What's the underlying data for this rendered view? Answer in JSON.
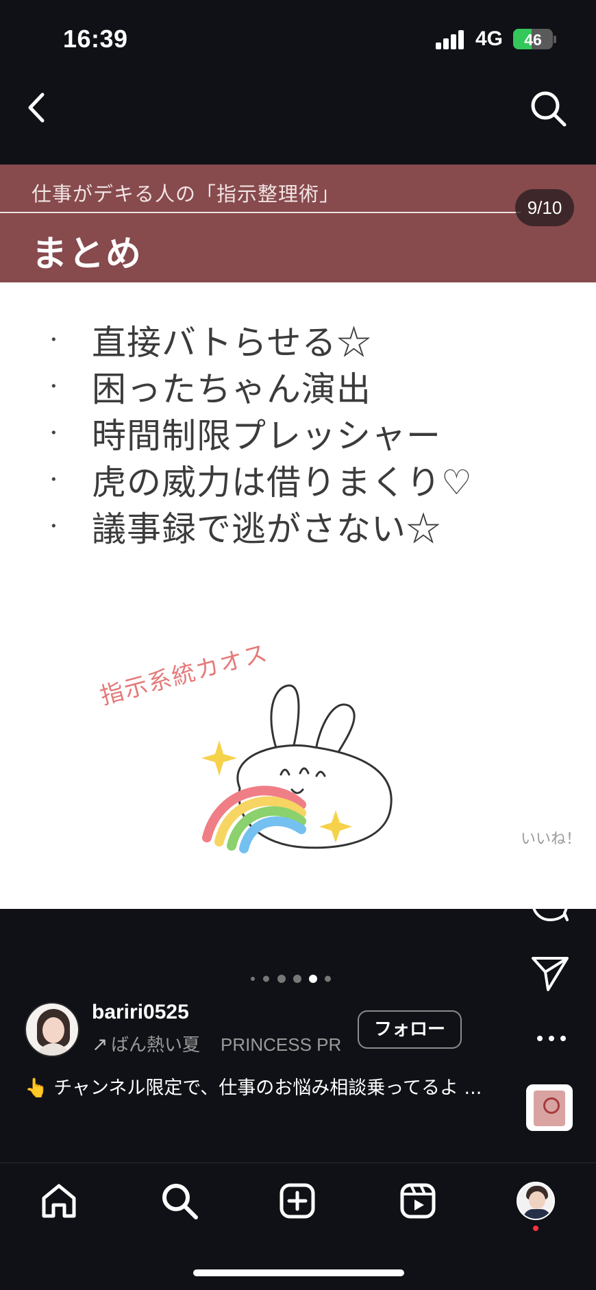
{
  "status_bar": {
    "time": "16:39",
    "network": "4G",
    "battery": "46",
    "battery_level": 0.46
  },
  "nav": {
    "back_icon": "chevron-left-icon",
    "search_icon": "search-icon"
  },
  "post": {
    "subtitle": "仕事がデキる人の「指示整理術」",
    "title": "まとめ",
    "page_counter": "9/10",
    "bullets": [
      "直接バトらせる☆",
      "困ったちゃん演出",
      "時間制限プレッシャー",
      "虎の威力は借りまくり♡",
      "議事録で逃がさない☆"
    ],
    "handwritten_label": "指示系統カオス",
    "colors": {
      "header": "#874a4d",
      "accent_text": "#e47a7a"
    }
  },
  "actions": {
    "like_label": "いいね！"
  },
  "carousel": {
    "total_dots": 6,
    "active_index": 4
  },
  "author": {
    "username": "bariri0525",
    "audio_track_1": "ばん熱い夏",
    "audio_track_2": "PRINCESS PR",
    "follow_label": "フォロー"
  },
  "caption": {
    "text": "👆 チャンネル限定で、仕事のお悩み相談乗ってるよ ..."
  },
  "tabbar": {
    "items": [
      "home-icon",
      "search-icon",
      "create-icon",
      "reels-icon",
      "profile-avatar"
    ]
  }
}
